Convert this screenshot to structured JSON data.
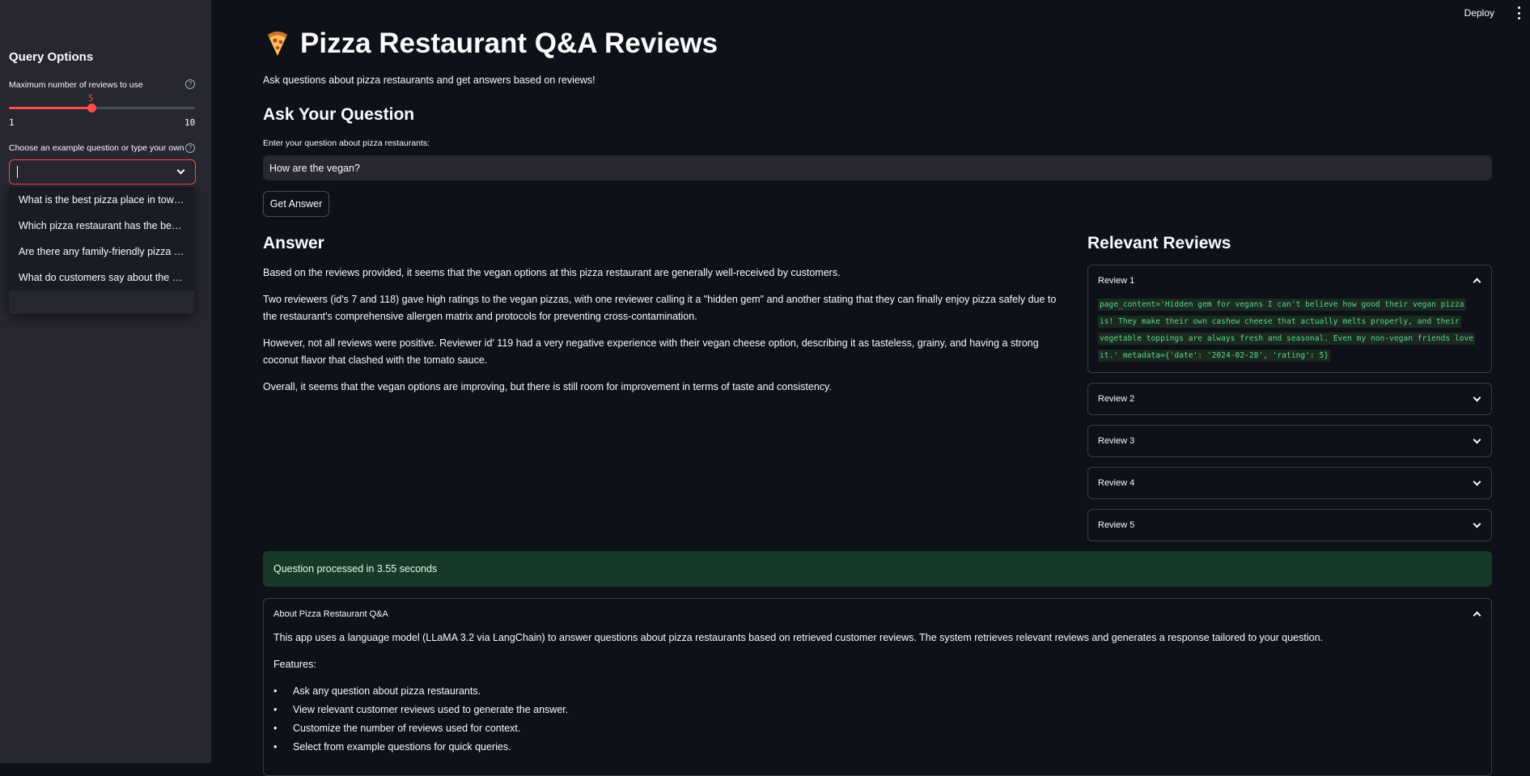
{
  "header": {
    "deploy_label": "Deploy"
  },
  "sidebar": {
    "title": "Query Options",
    "slider": {
      "label": "Maximum number of reviews to use",
      "value": 5,
      "min": 1,
      "max": 10,
      "value_label": "5",
      "min_label": "1",
      "max_label": "10"
    },
    "select": {
      "label": "Choose an example question or type your own",
      "value": "",
      "options": [
        "What is the best pizza place in town?",
        "Which pizza restaurant has the best ...",
        "Are there any family-friendly pizza p...",
        "What do customers say about the se..."
      ]
    }
  },
  "main": {
    "title": "Pizza Restaurant Q&A Reviews",
    "subtitle": "Ask questions about pizza restaurants and get answers based on reviews!",
    "ask_heading": "Ask Your Question",
    "input_label": "Enter your question about pizza restaurants:",
    "input_value": "How are the vegan?",
    "button_label": "Get Answer",
    "answer_heading": "Answer",
    "answer_paragraphs": [
      "Based on the reviews provided, it seems that the vegan options at this pizza restaurant are generally well-received by customers.",
      "Two reviewers (id's 7 and 118) gave high ratings to the vegan pizzas, with one reviewer calling it a \"hidden gem\" and another stating that they can finally enjoy pizza safely due to the restaurant's comprehensive allergen matrix and protocols for preventing cross-contamination.",
      "However, not all reviews were positive. Reviewer id' 119 had a very negative experience with their vegan cheese option, describing it as tasteless, grainy, and having a strong coconut flavor that clashed with the tomato sauce.",
      "Overall, it seems that the vegan options are improving, but there is still room for improvement in terms of taste and consistency."
    ],
    "reviews_heading": "Relevant Reviews",
    "reviews": [
      {
        "label": "Review 1",
        "expanded": true,
        "content": "page_content='Hidden gem for vegans I can't believe how good their vegan pizza is! They make their own cashew cheese that actually melts properly, and their vegetable toppings are always fresh and seasonal. Even my non-vegan friends love it.' metadata={'date': '2024-02-28', 'rating': 5}"
      },
      {
        "label": "Review 2",
        "expanded": false
      },
      {
        "label": "Review 3",
        "expanded": false
      },
      {
        "label": "Review 4",
        "expanded": false
      },
      {
        "label": "Review 5",
        "expanded": false
      }
    ],
    "status": "Question processed in 3.55 seconds",
    "about": {
      "label": "About Pizza Restaurant Q&A",
      "description": "This app uses a language model (LLaMA 3.2 via LangChain) to answer questions about pizza restaurants based on retrieved customer reviews. The system retrieves relevant reviews and generates a response tailored to your question.",
      "features_label": "Features:",
      "features": [
        "Ask any question about pizza restaurants.",
        "View relevant customer reviews used to generate the answer.",
        "Customize the number of reviews used for context.",
        "Select from example questions for quick queries."
      ]
    }
  },
  "colors": {
    "accent": "#ff4b4b",
    "success_bg": "#173928",
    "code_green": "#5fd38d"
  }
}
